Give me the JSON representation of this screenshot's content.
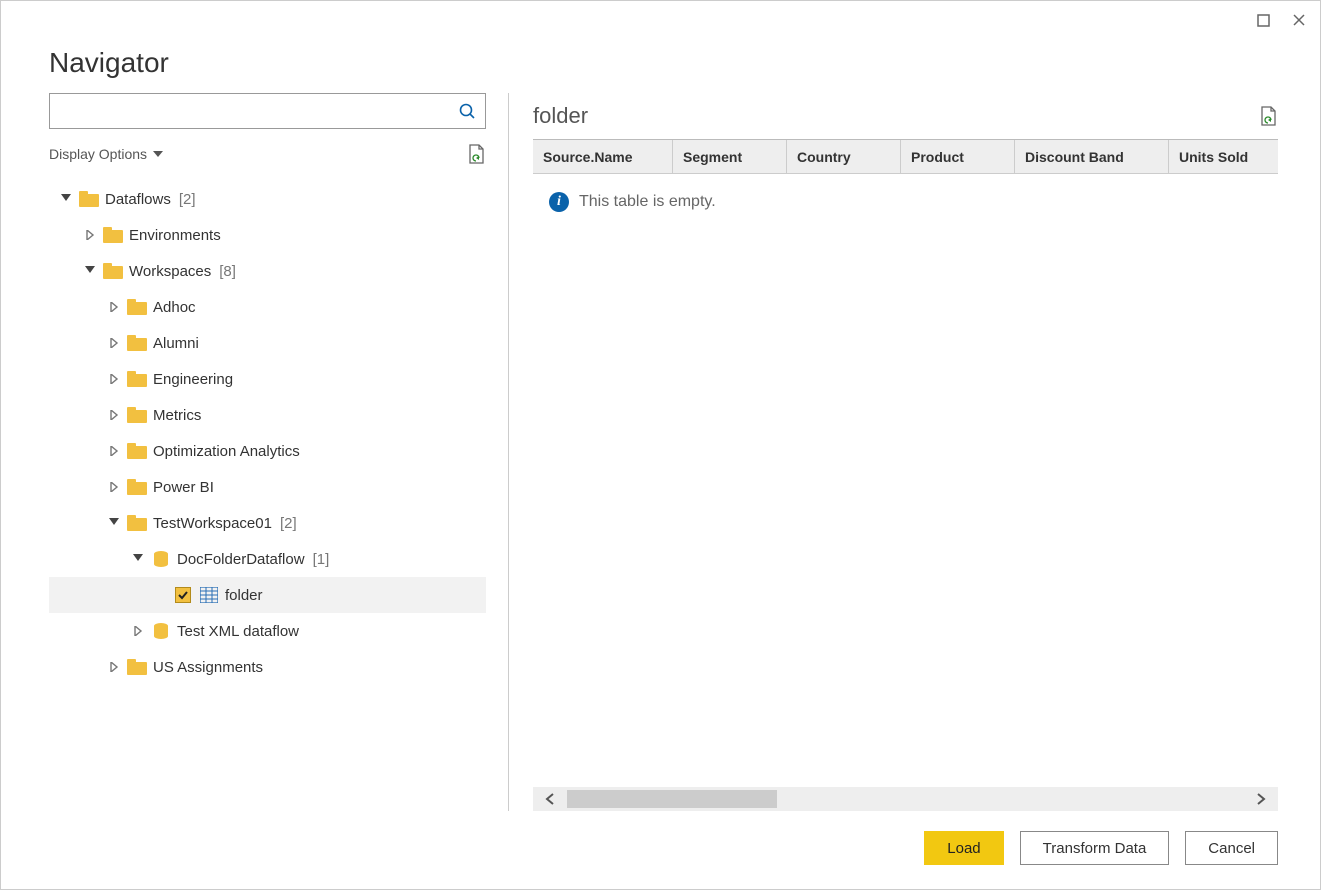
{
  "window": {
    "title": "Navigator"
  },
  "search": {
    "placeholder": ""
  },
  "optionsLabel": "Display Options",
  "tree": {
    "root": {
      "label": "Dataflows",
      "count": "[2]",
      "items": [
        {
          "label": "Environments"
        },
        {
          "label": "Workspaces",
          "count": "[8]",
          "items": [
            {
              "label": "Adhoc"
            },
            {
              "label": "Alumni"
            },
            {
              "label": "Engineering"
            },
            {
              "label": "Metrics"
            },
            {
              "label": "Optimization Analytics"
            },
            {
              "label": "Power BI"
            },
            {
              "label": "TestWorkspace01",
              "count": "[2]",
              "items": [
                {
                  "label": "DocFolderDataflow",
                  "count": "[1]",
                  "items": [
                    {
                      "label": "folder",
                      "checked": true
                    }
                  ]
                },
                {
                  "label": "Test XML dataflow"
                }
              ]
            },
            {
              "label": "US Assignments"
            }
          ]
        }
      ]
    }
  },
  "preview": {
    "title": "folder",
    "columns": [
      "Source.Name",
      "Segment",
      "Country",
      "Product",
      "Discount Band",
      "Units Sold"
    ],
    "emptyMessage": "This table is empty."
  },
  "buttons": {
    "load": "Load",
    "transform": "Transform Data",
    "cancel": "Cancel"
  }
}
